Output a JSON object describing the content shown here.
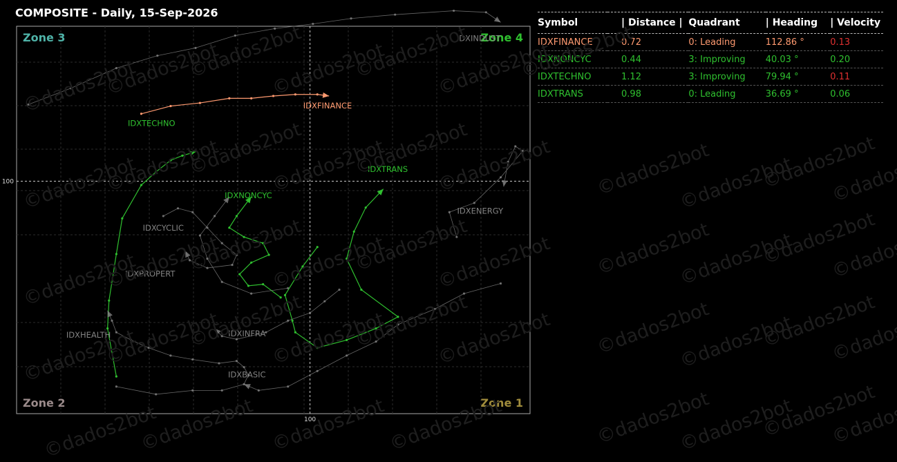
{
  "title": "COMPOSITE - Daily, 15-Sep-2026",
  "watermark_text": "©dados2bot",
  "colors": {
    "zone3": "#4fb3a8",
    "zone4": "#2fc02f",
    "zone2": "#9a8a8a",
    "zone1": "#a08c3c",
    "green": "#2fc02f",
    "finance": "#ff9a70",
    "gray": "#8a8a8a",
    "red": "#e03030"
  },
  "table": {
    "headers": [
      "Symbol",
      "| Distance |",
      "Quadrant",
      "| Heading",
      "| Velocity"
    ],
    "rows": [
      {
        "symbol": "IDXFINANCE",
        "distance": "0.72",
        "quadrant": "0: Leading",
        "heading": "112.86 °",
        "velocity": "0.13",
        "color": "#ff9a70",
        "velocity_color": "#e03030"
      },
      {
        "symbol": "IDXNONCYC",
        "distance": "0.44",
        "quadrant": "3: Improving",
        "heading": "40.03 °",
        "velocity": "0.20",
        "color": "#2fc02f",
        "velocity_color": "#2fc02f"
      },
      {
        "symbol": "IDXTECHNO",
        "distance": "1.12",
        "quadrant": "3: Improving",
        "heading": "79.94 °",
        "velocity": "0.11",
        "color": "#2fc02f",
        "velocity_color": "#e03030"
      },
      {
        "symbol": "IDXTRANS",
        "distance": "0.98",
        "quadrant": "0: Leading",
        "heading": "36.69 °",
        "velocity": "0.06",
        "color": "#2fc02f",
        "velocity_color": "#2fc02f"
      }
    ]
  },
  "chart_data": {
    "type": "scatter",
    "title": "COMPOSITE - Daily, 15-Sep-2026",
    "xlim": [
      98.0,
      101.5
    ],
    "ylim": [
      97.0,
      102.0
    ],
    "x_ticks": [
      100
    ],
    "y_ticks": [
      100
    ],
    "grid": true,
    "zones": [
      {
        "label": "Zone 3",
        "position": "top-left",
        "color": "#4fb3a8"
      },
      {
        "label": "Zone 4",
        "position": "top-right",
        "color": "#2fc02f"
      },
      {
        "label": "Zone 2",
        "position": "bottom-left",
        "color": "#9a8a8a"
      },
      {
        "label": "Zone 1",
        "position": "bottom-right",
        "color": "#a08c3c"
      }
    ],
    "series": [
      {
        "name": "IDXINDUST",
        "color": "#8a8a8a",
        "points": [
          [
            98.08,
            100.99
          ],
          [
            98.37,
            101.2
          ],
          [
            98.68,
            101.46
          ],
          [
            98.96,
            101.62
          ],
          [
            99.22,
            101.72
          ],
          [
            99.49,
            101.88
          ],
          [
            99.76,
            101.97
          ],
          [
            100.02,
            102.03
          ],
          [
            100.28,
            102.1
          ],
          [
            100.58,
            102.15
          ],
          [
            100.98,
            102.2
          ],
          [
            101.2,
            102.18
          ],
          [
            101.3,
            102.05
          ]
        ],
        "label_xy": [
          101.15,
          101.81
        ]
      },
      {
        "name": "IDXFINANCE",
        "color": "#ff9a70",
        "points": [
          [
            98.85,
            100.87
          ],
          [
            99.05,
            100.97
          ],
          [
            99.25,
            101.01
          ],
          [
            99.45,
            101.07
          ],
          [
            99.6,
            101.07
          ],
          [
            99.75,
            101.1
          ],
          [
            99.9,
            101.12
          ],
          [
            100.05,
            101.12
          ],
          [
            100.13,
            101.1
          ]
        ],
        "label_xy": [
          100.12,
          100.94
        ]
      },
      {
        "name": "IDXTECHNO",
        "color": "#2fc02f",
        "points": [
          [
            98.68,
            97.48
          ],
          [
            98.62,
            98.1
          ],
          [
            98.63,
            98.46
          ],
          [
            98.68,
            99.06
          ],
          [
            98.72,
            99.52
          ],
          [
            98.85,
            99.95
          ],
          [
            98.95,
            100.12
          ],
          [
            99.05,
            100.27
          ],
          [
            99.13,
            100.33
          ],
          [
            99.22,
            100.38
          ]
        ],
        "label_xy": [
          98.92,
          100.71
        ]
      },
      {
        "name": "IDXNONCYC",
        "color": "#2fc02f",
        "points": [
          [
            99.8,
            98.5
          ],
          [
            99.68,
            98.67
          ],
          [
            99.58,
            98.65
          ],
          [
            99.52,
            98.8
          ],
          [
            99.6,
            98.95
          ],
          [
            99.72,
            99.05
          ],
          [
            99.68,
            99.2
          ],
          [
            99.55,
            99.28
          ],
          [
            99.45,
            99.4
          ],
          [
            99.5,
            99.55
          ],
          [
            99.6,
            99.8
          ]
        ],
        "label_xy": [
          99.58,
          99.78
        ]
      },
      {
        "name": "IDXTRANS",
        "color": "#2fc02f",
        "points": [
          [
            100.05,
            99.15
          ],
          [
            99.95,
            98.9
          ],
          [
            99.83,
            98.53
          ],
          [
            99.88,
            98.2
          ],
          [
            99.9,
            98.05
          ],
          [
            100.05,
            97.85
          ],
          [
            100.25,
            97.95
          ],
          [
            100.45,
            98.1
          ],
          [
            100.6,
            98.25
          ],
          [
            100.35,
            98.6
          ],
          [
            100.25,
            99.0
          ],
          [
            100.3,
            99.35
          ],
          [
            100.38,
            99.66
          ],
          [
            100.5,
            99.9
          ]
        ],
        "label_xy": [
          100.53,
          100.12
        ]
      },
      {
        "name": "IDXENERGY",
        "color": "#8a8a8a",
        "points": [
          [
            101.0,
            99.28
          ],
          [
            100.95,
            99.6
          ],
          [
            101.12,
            99.72
          ],
          [
            101.3,
            100.05
          ],
          [
            101.45,
            100.39
          ],
          [
            101.4,
            100.45
          ],
          [
            101.35,
            100.25
          ],
          [
            101.32,
            99.93
          ]
        ],
        "label_xy": [
          101.16,
          99.58
        ]
      },
      {
        "name": "IDXCYCLIC",
        "color": "#8a8a8a",
        "points": [
          [
            99.85,
            98.62
          ],
          [
            99.6,
            98.55
          ],
          [
            99.4,
            98.7
          ],
          [
            99.3,
            99.0
          ],
          [
            99.25,
            99.3
          ],
          [
            99.35,
            99.55
          ],
          [
            99.45,
            99.8
          ]
        ],
        "label_xy": [
          99.0,
          99.36
        ]
      },
      {
        "name": "IDXPROPERT",
        "color": "#8a8a8a",
        "points": [
          [
            99.0,
            99.55
          ],
          [
            99.1,
            99.65
          ],
          [
            99.2,
            99.6
          ],
          [
            99.3,
            99.4
          ],
          [
            99.4,
            99.2
          ],
          [
            99.5,
            99.05
          ],
          [
            99.47,
            98.92
          ],
          [
            99.3,
            98.88
          ],
          [
            99.18,
            98.98
          ],
          [
            99.15,
            99.1
          ]
        ],
        "label_xy": [
          98.91,
          98.77
        ]
      },
      {
        "name": "IDXINFRA",
        "color": "#8a8a8a",
        "points": [
          [
            100.2,
            98.6
          ],
          [
            100.1,
            98.45
          ],
          [
            100.0,
            98.3
          ],
          [
            99.85,
            98.2
          ],
          [
            99.7,
            98.05
          ],
          [
            99.5,
            97.96
          ],
          [
            99.4,
            98.0
          ],
          [
            99.35,
            98.1
          ]
        ],
        "label_xy": [
          99.57,
          98.0
        ]
      },
      {
        "name": "IDXHEALTH",
        "color": "#8a8a8a",
        "points": [
          [
            98.68,
            97.35
          ],
          [
            98.95,
            97.25
          ],
          [
            99.2,
            97.3
          ],
          [
            99.4,
            97.3
          ],
          [
            99.55,
            97.38
          ],
          [
            99.58,
            97.5
          ],
          [
            99.55,
            97.6
          ],
          [
            99.5,
            97.68
          ],
          [
            99.38,
            97.65
          ],
          [
            99.2,
            97.7
          ],
          [
            99.05,
            97.75
          ],
          [
            98.9,
            97.85
          ],
          [
            98.78,
            97.95
          ],
          [
            98.68,
            98.05
          ],
          [
            98.65,
            98.2
          ],
          [
            98.62,
            98.33
          ]
        ],
        "label_xy": [
          98.49,
          97.98
        ]
      },
      {
        "name": "IDXBASIC",
        "color": "#8a8a8a",
        "points": [
          [
            101.3,
            98.68
          ],
          [
            101.05,
            98.55
          ],
          [
            100.85,
            98.35
          ],
          [
            100.6,
            98.15
          ],
          [
            100.45,
            97.93
          ],
          [
            100.25,
            97.75
          ],
          [
            100.05,
            97.55
          ],
          [
            99.85,
            97.35
          ],
          [
            99.65,
            97.3
          ],
          [
            99.55,
            97.38
          ]
        ],
        "label_xy": [
          99.57,
          97.47
        ]
      }
    ]
  }
}
